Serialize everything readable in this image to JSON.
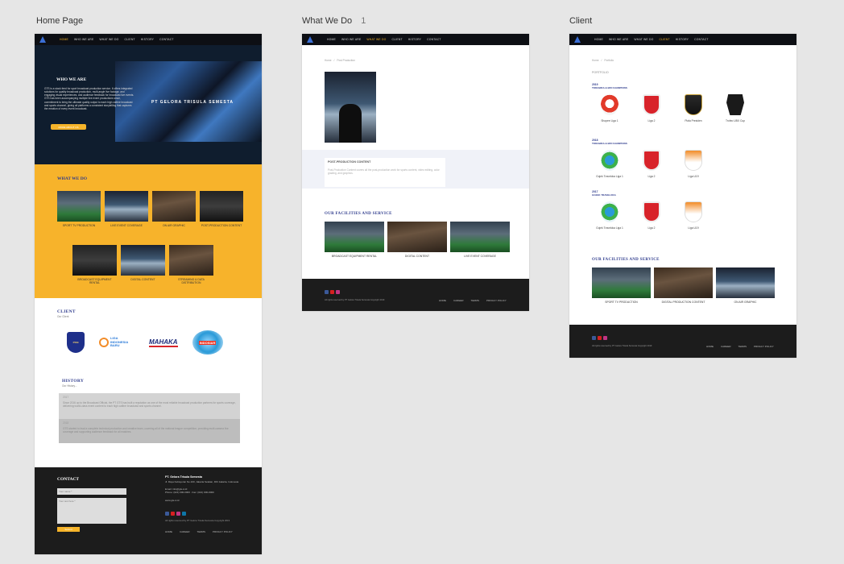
{
  "boards": {
    "home": {
      "label": "Home Page"
    },
    "whatwedo": {
      "label": "What We Do",
      "count": "1"
    },
    "client": {
      "label": "Client"
    }
  },
  "nav": {
    "items": [
      "HOME",
      "WHO WE ARE",
      "WHAT WE DO",
      "CLIENT",
      "HISTORY",
      "CONTACT"
    ]
  },
  "home": {
    "hero": {
      "title": "WHO WE ARE",
      "body": "GTS is a stock feed for sport broadcast production service. It offers integrated solutions for quality broadcast production, multi-angle live footage, and engaging visual experiences, and audience feedback for broadcast live events. GTS has been accompanying multiple live event productions since, commitment to bring the ultimate quality output to each high calibre broadcast and sports channel, giving all platforms a consistent storytelling that captures the emotion of every event broadcast.",
      "button": "MORE ABOUT US",
      "brand_text": "PT GELORA TRISULA SEMESTA"
    },
    "whatwedo": {
      "title": "WHAT WE DO",
      "services": [
        "SPORT TV PRODUCTION",
        "LIVE EVENT COVERAGE",
        "ON AIR GRAPHIC",
        "POST-PRODUCTION CONTENT",
        "BROADCAST EQUIPMENT RENTAL",
        "DIGITAL CONTENT",
        "STREAMING & DATA DISTRIBUTION"
      ]
    },
    "client": {
      "title": "CLIENT",
      "subtitle": "Our Client",
      "logos": [
        "PSSI",
        "LIGA INDONESIA BARU",
        "MAHAKA",
        "INDOSIAR"
      ]
    },
    "history": {
      "title": "HISTORY",
      "subtitle": "Our History...",
      "entries": [
        {
          "year": "2017",
          "text": "Since 2016 up to the Broadcast Official, the PT GTS has built a reputation as one of the most reliable broadcast production partners for sports coverage, delivering world-class event content to each high calibre broadcast and sports channel."
        },
        {
          "year": "2018",
          "text": "GTS started to lead a complete technical production and creative team, covering all of the national league competition, providing multi-camera live coverage and supporting audience feedback for all matches."
        }
      ]
    },
    "contact": {
      "title": "CONTACT",
      "name_placeholder": "Your name *",
      "message_placeholder": "Your text here *",
      "submit": "Submit",
      "company": "PT. Gelora Trisula Semesta",
      "address": "Jl. Raya Kebayoran No.100, Jakarta Selatan, DKI Jakarta, Indonesia",
      "email": "Email: info@gts-tv.id",
      "phone": "Phone: (021) 000-0000 · Fax: (021) 000-0000",
      "website": "www.gts-tv.id",
      "copyright": "All rights reserved by PT Gelora Trisula Semesta Copyright 2019"
    }
  },
  "whatwedo_page": {
    "breadcrumb": [
      "Home",
      "Post Production"
    ],
    "section_title": "POST-PRODUCTION CONTENT",
    "section_text": "Post-Production Content covers all the post-production work for sports content, video editing, color grading, and graphics.",
    "facilities_title": "OUR FACILITIES AND SERVICE",
    "facilities": [
      "BROADCAST EQUIPMENT RENTAL",
      "DIGITAL CONTENT",
      "LIVE EVENT COVERAGE"
    ]
  },
  "client_page": {
    "breadcrumb": [
      "Home",
      "Portfolio"
    ],
    "heading": "PORTFOLIO",
    "groups": [
      {
        "year": "2019",
        "subtitle": "TORABIKA & BRI CHAMPIONS",
        "items": [
          "Shopee Liga 1",
          "Liga 2",
          "Piala Presiden",
          "Trofeo UBX Cup"
        ]
      },
      {
        "year": "2018",
        "subtitle": "TORABIKA & BRI CHAMPIONS",
        "items": [
          "Gojek Traveloka Liga 1",
          "Liga 2",
          "Liga U19"
        ]
      },
      {
        "year": "2017",
        "subtitle": "GOJEK TRAVELOKA",
        "items": [
          "Gojek Traveloka Liga 1",
          "Liga 2",
          "Liga U19"
        ]
      }
    ],
    "facilities_title": "OUR FACILITIES AND SERVICE",
    "facilities": [
      "SPORT TV PRODUCTION",
      "DIGITAL PRODUCTION CONTENT",
      "ON AIR GRAPHIC"
    ]
  },
  "footer": {
    "copyright": "All rights reserved by PT Gelora Trisula Semesta Copyright 2019",
    "links": [
      "HOME",
      "CAREER",
      "TERMS",
      "PRIVACY POLICY"
    ]
  },
  "colors": {
    "accent": "#f6b42a",
    "nav": "#0d0f14",
    "blue": "#2d3a8c",
    "footer": "#1c1c1c"
  }
}
